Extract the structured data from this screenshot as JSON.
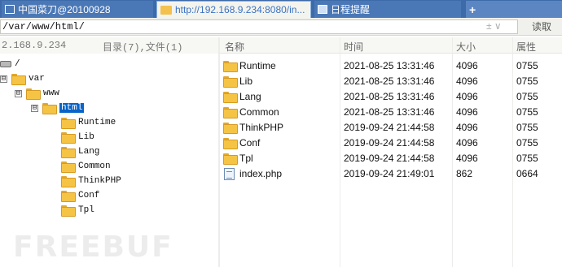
{
  "tabs": [
    {
      "label": "中国菜刀@20100928",
      "icon": "window-icon"
    },
    {
      "label": "http://192.168.9.234:8080/in...",
      "icon": "folder-icon"
    },
    {
      "label": "日程提醒",
      "icon": "calendar-icon"
    },
    {
      "label": "+",
      "icon": "new-tab-icon"
    }
  ],
  "address": {
    "path": "/var/www/html/",
    "dropdown_arrows": "± ∨",
    "read_label": "读取"
  },
  "left_header": {
    "host": "2.168.9.234",
    "count": "目录(7),文件(1)"
  },
  "tree": {
    "root": "/",
    "nodes": [
      {
        "label": "var",
        "toggle": "⊟"
      },
      {
        "label": "www",
        "toggle": "⊟"
      },
      {
        "label": "html",
        "toggle": "⊟",
        "selected": true
      }
    ],
    "children": [
      "Runtime",
      "Lib",
      "Lang",
      "Common",
      "ThinkPHP",
      "Conf",
      "Tpl"
    ]
  },
  "file_list": {
    "columns": [
      "名称",
      "时间",
      "大小",
      "属性"
    ],
    "rows": [
      {
        "name": "Runtime",
        "time": "2021-08-25 13:31:46",
        "size": "4096",
        "attr": "0755",
        "type": "folder"
      },
      {
        "name": "Lib",
        "time": "2021-08-25 13:31:46",
        "size": "4096",
        "attr": "0755",
        "type": "folder"
      },
      {
        "name": "Lang",
        "time": "2021-08-25 13:31:46",
        "size": "4096",
        "attr": "0755",
        "type": "folder"
      },
      {
        "name": "Common",
        "time": "2021-08-25 13:31:46",
        "size": "4096",
        "attr": "0755",
        "type": "folder"
      },
      {
        "name": "ThinkPHP",
        "time": "2019-09-24 21:44:58",
        "size": "4096",
        "attr": "0755",
        "type": "folder"
      },
      {
        "name": "Conf",
        "time": "2019-09-24 21:44:58",
        "size": "4096",
        "attr": "0755",
        "type": "folder"
      },
      {
        "name": "Tpl",
        "time": "2019-09-24 21:44:58",
        "size": "4096",
        "attr": "0755",
        "type": "folder"
      },
      {
        "name": "index.php",
        "time": "2019-09-24 21:49:01",
        "size": "862",
        "attr": "0664",
        "type": "file"
      }
    ]
  },
  "watermark": "FREEBUF",
  "colors": {
    "tab_bar": "#3d6aa8",
    "active_tab_text": "#3a72c4",
    "selection": "#0a64c8",
    "folder": "#f6c445"
  }
}
